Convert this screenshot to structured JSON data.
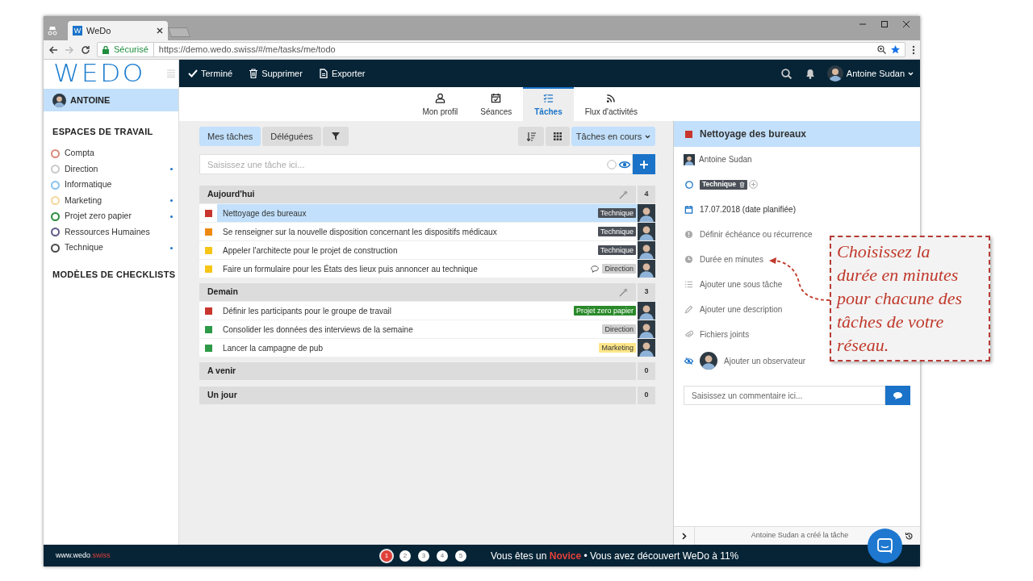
{
  "browser": {
    "tab_title": "WeDo",
    "favicon": "W",
    "security": "Sécurisé",
    "url": "https://demo.wedo.swiss/#/me/tasks/me/todo"
  },
  "topbar": {
    "actions": [
      {
        "kind": "check",
        "label": "Terminé"
      },
      {
        "kind": "trash",
        "label": "Supprimer"
      },
      {
        "kind": "file",
        "label": "Exporter"
      }
    ],
    "user": "Antoine Sudan"
  },
  "sidebar": {
    "logo": "WEDO",
    "user": "ANTOINE",
    "workspaces_title": "ESPACES DE TRAVAIL",
    "workspaces": [
      {
        "label": "Compta",
        "color": "#d98a7a",
        "unread": false
      },
      {
        "label": "Direction",
        "color": "#c9c9c9",
        "unread": true
      },
      {
        "label": "Informatique",
        "color": "#88c2ee",
        "unread": false
      },
      {
        "label": "Marketing",
        "color": "#f5d79a",
        "unread": true
      },
      {
        "label": "Projet zero papier",
        "color": "#2e8b3e",
        "unread": true
      },
      {
        "label": "Ressources Humaines",
        "color": "#5c5a86",
        "unread": false
      },
      {
        "label": "Technique",
        "color": "#4a4a4a",
        "unread": true
      }
    ],
    "checklists_title": "MODÈLES DE CHECKLISTS"
  },
  "nav_tabs": [
    {
      "kind": "user",
      "label": "Mon profil",
      "selected": false
    },
    {
      "kind": "calendar",
      "label": "Séances",
      "selected": false
    },
    {
      "kind": "list",
      "label": "Tâches",
      "selected": true
    },
    {
      "kind": "rss",
      "label": "Flux d'activités",
      "selected": false
    }
  ],
  "task_toolbar": {
    "filters": [
      {
        "label": "Mes tâches",
        "selected": true
      },
      {
        "label": "Déléguées",
        "selected": false
      }
    ],
    "status": "Tâches en cours"
  },
  "new_task": {
    "placeholder": "Saisissez une tâche ici..."
  },
  "groups": [
    {
      "title": "Aujourd'hui",
      "count": "4",
      "editable": true,
      "tasks": [
        {
          "title": "Nettoyage des bureaux",
          "color": "#c8362f",
          "selected": true,
          "comment": false,
          "tag": {
            "label": "Technique",
            "color": "#4b5058"
          }
        },
        {
          "title": "Se renseigner sur la nouvelle disposition concernant les dispositifs médicaux",
          "color": "#ee8a12",
          "selected": false,
          "comment": false,
          "tag": {
            "label": "Technique",
            "color": "#4b5058"
          }
        },
        {
          "title": "Appeler l'architecte pour le projet de construction",
          "color": "#f5c518",
          "selected": false,
          "comment": false,
          "tag": {
            "label": "Technique",
            "color": "#4b5058"
          }
        },
        {
          "title": "Faire un formulaire pour les États des lieux puis annoncer au technique",
          "color": "#f5c518",
          "selected": false,
          "comment": true,
          "tag": {
            "label": "Direction",
            "color": "#d0d0d0"
          }
        }
      ]
    },
    {
      "title": "Demain",
      "count": "3",
      "editable": true,
      "tasks": [
        {
          "title": "Définir les participants pour le groupe de travail",
          "color": "#c8362f",
          "selected": false,
          "comment": false,
          "tag": {
            "label": "Projet zero papier",
            "color": "#2a8a2a"
          }
        },
        {
          "title": "Consolider les données des interviews de la semaine",
          "color": "#2e9a48",
          "selected": false,
          "comment": false,
          "tag": {
            "label": "Direction",
            "color": "#d0d0d0"
          }
        },
        {
          "title": "Lancer la campagne de pub",
          "color": "#2e9a48",
          "selected": false,
          "comment": false,
          "tag": {
            "label": "Marketing",
            "color": "#fde68a"
          }
        }
      ]
    },
    {
      "title": "A venir",
      "count": "0",
      "editable": false
    },
    {
      "title": "Un jour",
      "count": "0",
      "editable": false
    }
  ],
  "detail": {
    "title": "Nettoyage des bureaux",
    "color": "#c8362f",
    "assignee": "Antoine Sudan",
    "tag": {
      "label": "Technique",
      "color": "#4b5058"
    },
    "fields": [
      {
        "kind": "calendar",
        "label": "17.07.2018 (date planifiée)",
        "set": true
      },
      {
        "kind": "alert",
        "label": "Définir échéance ou récurrence",
        "set": false
      },
      {
        "kind": "clock",
        "label": "Durée en minutes",
        "set": false
      },
      {
        "kind": "list",
        "label": "Ajouter une sous tâche",
        "set": false
      },
      {
        "kind": "pencil",
        "label": "Ajouter une description",
        "set": false
      },
      {
        "kind": "clip",
        "label": "Fichiers joints",
        "set": false
      },
      {
        "kind": "observer",
        "label": "Ajouter un observateur",
        "set": false
      }
    ],
    "comment_placeholder": "Saisissez un commentaire ici...",
    "history": "Antoine Sudan a créé la tâche"
  },
  "footer": {
    "site": "www.wedo",
    "site_suffix": ".swiss",
    "steps": [
      {
        "label": "1",
        "current": true
      },
      {
        "label": "2",
        "current": false
      },
      {
        "label": "3",
        "current": false
      },
      {
        "label": "4",
        "current": false
      },
      {
        "label": "5",
        "current": false
      }
    ],
    "message": "Vous êtes un **Novice** • Vous avez découvert WeDo à 11%"
  },
  "callout": {
    "text": "Choisissez la durée en minutes pour chacune des tâches de votre réseau."
  }
}
